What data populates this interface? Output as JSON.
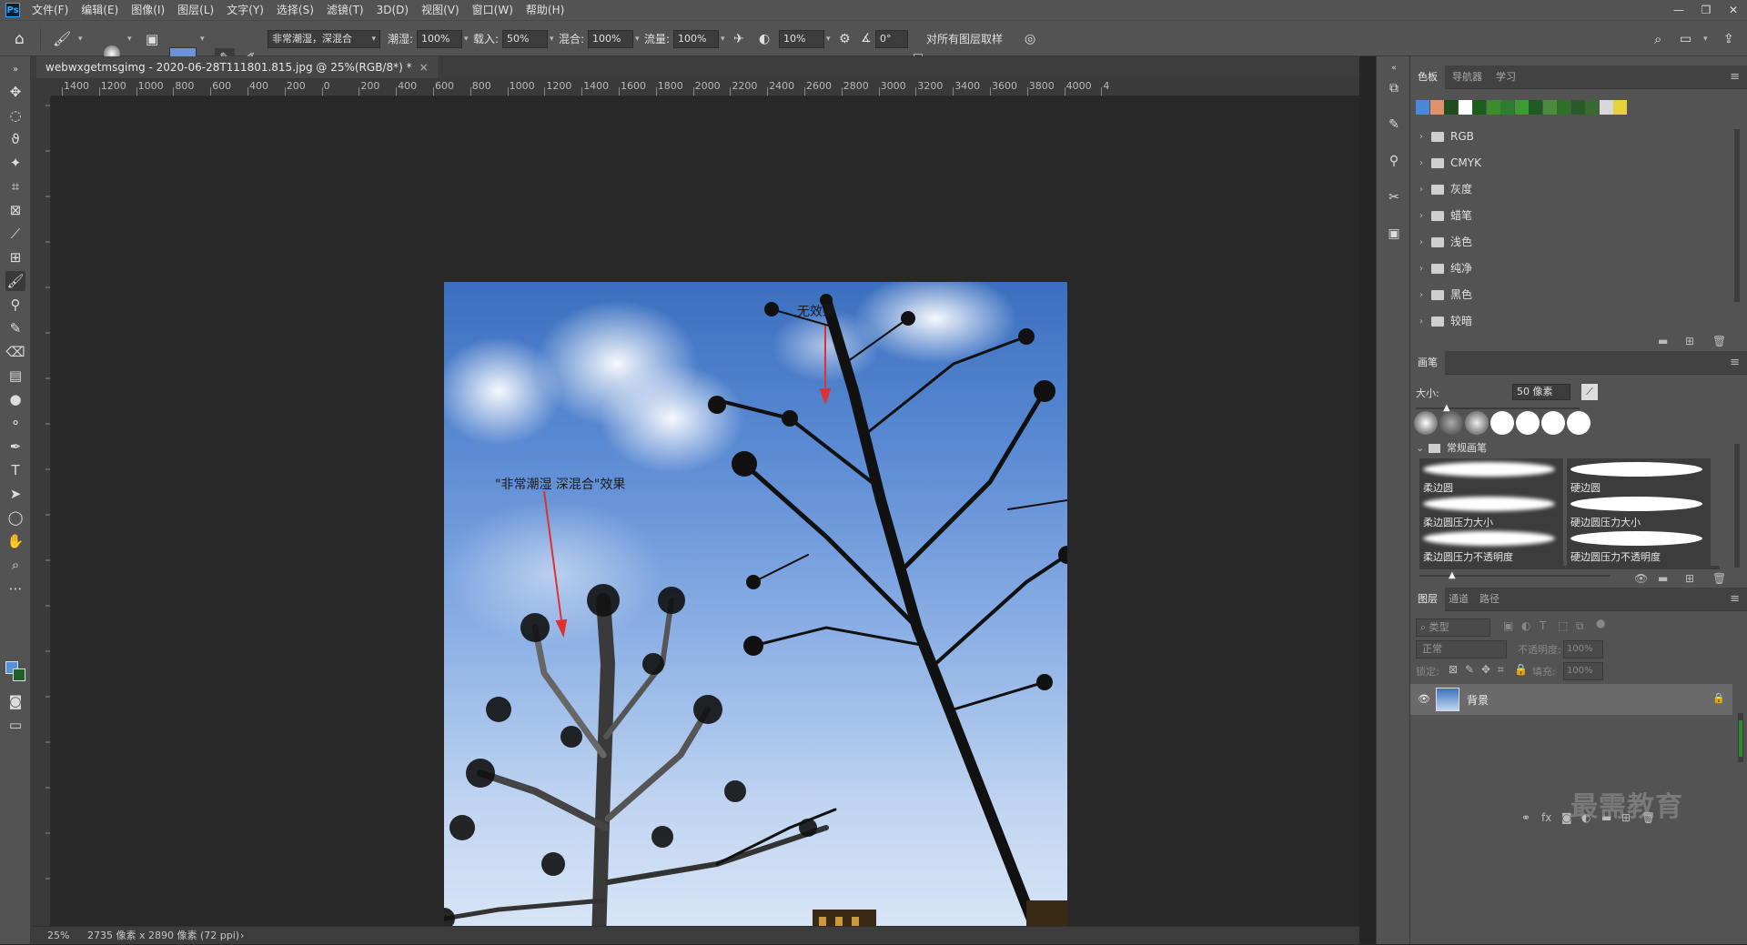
{
  "menubar": {
    "logo": "Ps",
    "items": [
      "文件(F)",
      "编辑(E)",
      "图像(I)",
      "图层(L)",
      "文字(Y)",
      "选择(S)",
      "滤镜(T)",
      "3D(D)",
      "视图(V)",
      "窗口(W)",
      "帮助(H)"
    ]
  },
  "options": {
    "brush_size": "50",
    "mode_preset": "非常潮湿，深混合",
    "wet_label": "潮湿:",
    "wet_value": "100%",
    "load_label": "载入:",
    "load_value": "50%",
    "mix_label": "混合:",
    "mix_value": "100%",
    "flow_label": "流量:",
    "flow_value": "100%",
    "smooth_value": "10%",
    "angle_value": "0°",
    "sample_all_label": "对所有图层取样"
  },
  "document": {
    "tab_title": "webwxgetmsgimg - 2020-06-28T111801.815.jpg @ 25%(RGB/8*) *",
    "ruler_h_labels": [
      "1400",
      "1200",
      "1000",
      "800",
      "600",
      "400",
      "200",
      "0",
      "200",
      "400",
      "600",
      "800",
      "1000",
      "1200",
      "1400",
      "1600",
      "1800",
      "2000",
      "2200",
      "2400",
      "2600",
      "2800",
      "3000",
      "3200",
      "3400",
      "3600",
      "3800",
      "4000",
      "4"
    ],
    "annotation_top": "无效果",
    "annotation_left": "\"非常潮湿 深混合\"效果"
  },
  "status": {
    "zoom": "25%",
    "doc_info": "2735 像素 x 2890 像素 (72 ppi)"
  },
  "swatches_panel": {
    "tabs": [
      "色板",
      "导航器",
      "学习"
    ],
    "colors": [
      "#4a88d8",
      "#e0906a",
      "#1f4d1f",
      "#ffffff",
      "#1b5e1b",
      "#3c8c2a",
      "#2e7d32",
      "#3f9a33",
      "#1e5a24",
      "#4a8c3c",
      "#2f6f2a",
      "#2a5a2a",
      "#386b32",
      "#d8d8d8",
      "#e8d23a"
    ],
    "groups": [
      "RGB",
      "CMYK",
      "灰度",
      "蜡笔",
      "浅色",
      "纯净",
      "黑色",
      "较暗"
    ]
  },
  "brush_panel": {
    "tab": "画笔",
    "size_label": "大小:",
    "size_value": "50 像素",
    "group_title": "常规画笔",
    "brushes": [
      "柔边圆",
      "硬边圆",
      "柔边圆压力大小",
      "硬边圆压力大小",
      "柔边圆压力不透明度",
      "硬边圆压力不透明度"
    ]
  },
  "layers_panel": {
    "tabs": [
      "图层",
      "通道",
      "路径"
    ],
    "filter_placeholder": "类型",
    "blend_mode": "正常",
    "opacity_label": "不透明度:",
    "opacity_value": "100%",
    "lock_label": "锁定:",
    "fill_label": "填充:",
    "fill_value": "100%",
    "layer_name": "背景"
  },
  "watermark": "最需教育"
}
